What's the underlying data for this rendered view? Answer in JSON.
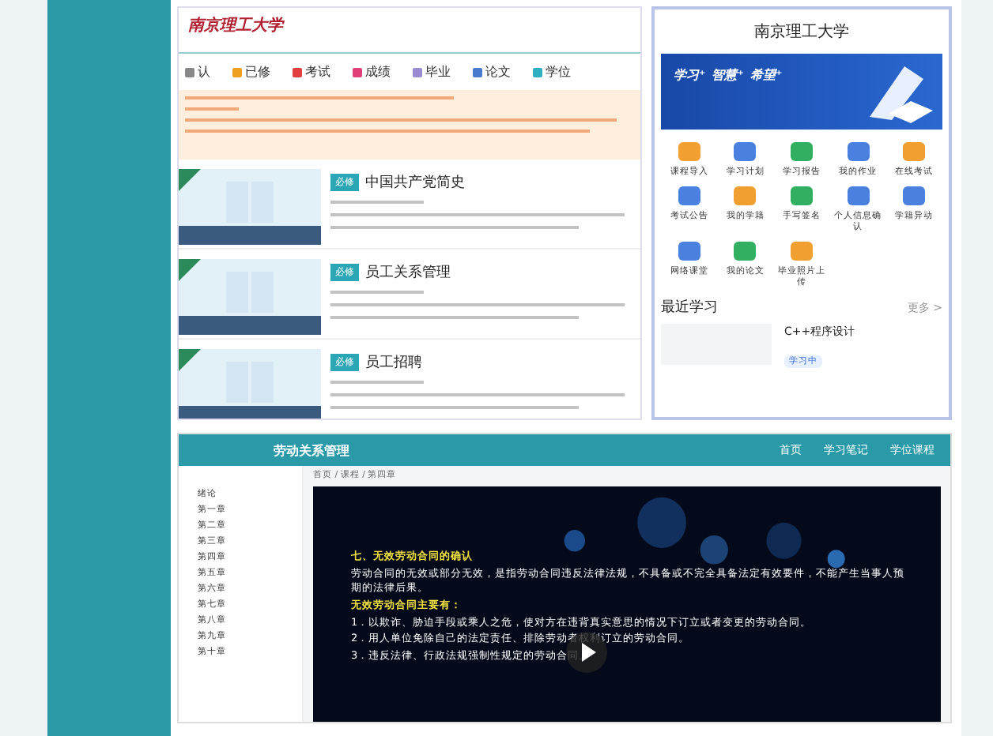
{
  "portal": {
    "logo": "南京理工大学",
    "nav": [
      {
        "label": "认",
        "color": "#888888"
      },
      {
        "label": "已修",
        "color": "#f0a020"
      },
      {
        "label": "考试",
        "color": "#e04040"
      },
      {
        "label": "成绩",
        "color": "#e0407a"
      },
      {
        "label": "毕业",
        "color": "#9a8ad0"
      },
      {
        "label": "论文",
        "color": "#4a7ad0"
      },
      {
        "label": "学位",
        "color": "#30b0c0"
      }
    ],
    "courses": [
      {
        "tag": "必修",
        "title": "中国共产党简史"
      },
      {
        "tag": "必修",
        "title": "员工关系管理"
      },
      {
        "tag": "必修",
        "title": "员工招聘"
      }
    ]
  },
  "mobile": {
    "title": "南京理工大学",
    "banner": [
      "学习⁺",
      "智慧⁺",
      "希望⁺"
    ],
    "apps": [
      {
        "label": "课程导入",
        "color": "#f0a030"
      },
      {
        "label": "学习计划",
        "color": "#4a80e0"
      },
      {
        "label": "学习报告",
        "color": "#30b060"
      },
      {
        "label": "我的作业",
        "color": "#4a80e0"
      },
      {
        "label": "在线考试",
        "color": "#f0a030"
      },
      {
        "label": "考试公告",
        "color": "#4a80e0"
      },
      {
        "label": "我的学籍",
        "color": "#f0a030"
      },
      {
        "label": "手写签名",
        "color": "#30b060"
      },
      {
        "label": "个人信息确认",
        "color": "#4a80e0"
      },
      {
        "label": "学籍异动",
        "color": "#4a80e0"
      },
      {
        "label": "网络课堂",
        "color": "#4a80e0"
      },
      {
        "label": "我的论文",
        "color": "#30b060"
      },
      {
        "label": "毕业照片上传",
        "color": "#f0a030"
      }
    ],
    "recent_title": "最近学习",
    "more": "更多 >",
    "recent": {
      "title": "C++程序设计",
      "status": "学习中"
    }
  },
  "player": {
    "title": "劳动关系管理",
    "nav": [
      "首页",
      "学习笔记",
      "学位课程"
    ],
    "breadcrumb": "首页 / 课程 / 第四章",
    "chapters": [
      "绪论",
      "第一章",
      "第二章",
      "第三章",
      "第四章",
      "第五章",
      "第六章",
      "第七章",
      "第八章",
      "第九章",
      "第十章"
    ],
    "slide": [
      {
        "kind": "heading",
        "text": "七、无效劳动合同的确认"
      },
      {
        "kind": "body",
        "text": "劳动合同的无效或部分无效，是指劳动合同违反法律法规，不具备或不完全具备法定有效要件，不能产生当事人预期的法律后果。"
      },
      {
        "kind": "heading",
        "text": "无效劳动合同主要有："
      },
      {
        "kind": "body",
        "text": "1．以欺诈、胁迫手段或乘人之危，使对方在违背真实意思的情况下订立或者变更的劳动合同。"
      },
      {
        "kind": "body",
        "text": "2．用人单位免除自己的法定责任、排除劳动者权利订立的劳动合同。"
      },
      {
        "kind": "body",
        "text": "3．违反法律、行政法规强制性规定的劳动合同。"
      }
    ]
  }
}
